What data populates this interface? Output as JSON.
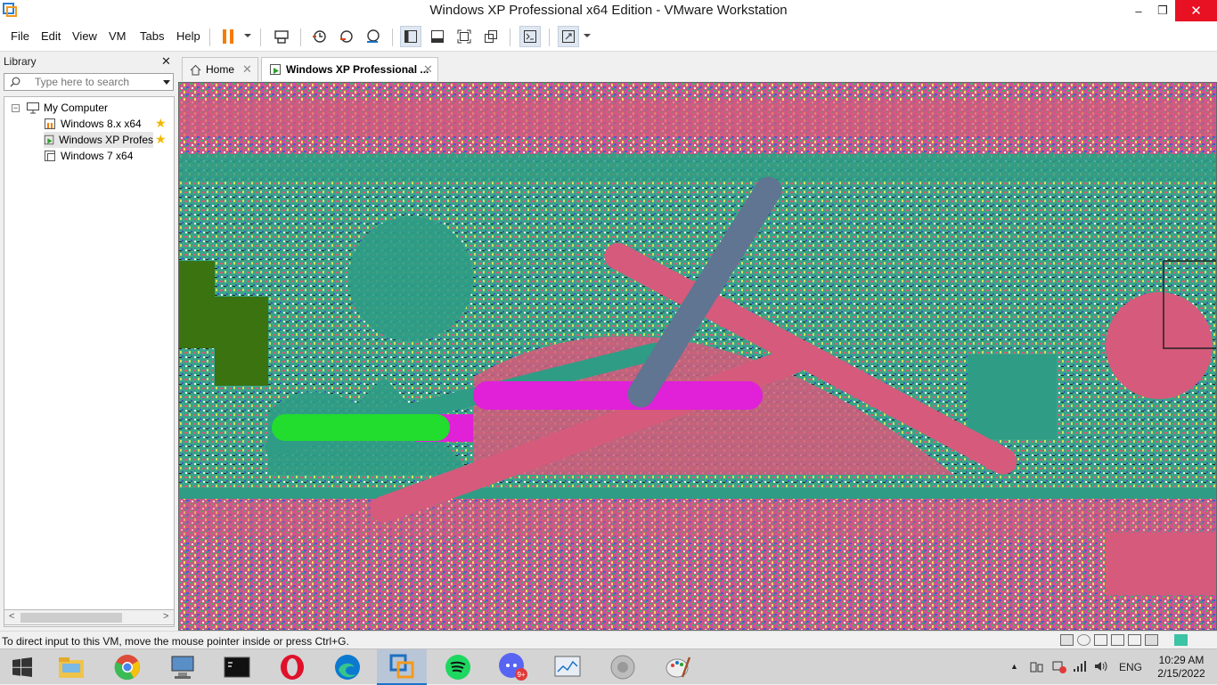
{
  "window": {
    "title": "Windows XP Professional x64 Edition - VMware Workstation",
    "minimize": "–",
    "maximize": "❐",
    "close": "✕"
  },
  "menu": {
    "items": [
      {
        "label": "File"
      },
      {
        "label": "Edit"
      },
      {
        "label": "View"
      },
      {
        "label": "VM"
      },
      {
        "label": "Tabs"
      },
      {
        "label": "Help"
      }
    ]
  },
  "library": {
    "title": "Library",
    "close": "✕",
    "search_placeholder": "Type here to search",
    "tree": {
      "root": "My Computer",
      "toggle": "−",
      "items": [
        {
          "label": "Windows 8.x x64",
          "favorite": true,
          "icon": "vm-suspended-icon"
        },
        {
          "label": "Windows XP Profes",
          "favorite": true,
          "icon": "vm-running-icon"
        },
        {
          "label": "Windows 7 x64",
          "favorite": false,
          "icon": "vm-icon"
        }
      ],
      "star": "★"
    },
    "scroll_left": "<",
    "scroll_right": ">"
  },
  "tabs": [
    {
      "label": "Home",
      "close": "✕"
    },
    {
      "label": "Windows XP Professional ...",
      "close": "✕"
    }
  ],
  "status": {
    "message": "To direct input to this VM, move the mouse pointer inside or press Ctrl+G."
  },
  "taskbar": {
    "apps": [
      {
        "name": "file-explorer"
      },
      {
        "name": "chrome"
      },
      {
        "name": "this-pc"
      },
      {
        "name": "command-prompt"
      },
      {
        "name": "opera"
      },
      {
        "name": "edge"
      },
      {
        "name": "vmware-workstation"
      },
      {
        "name": "spotify"
      },
      {
        "name": "discord",
        "badge": "9+"
      },
      {
        "name": "performance-monitor"
      },
      {
        "name": "speaker"
      },
      {
        "name": "paint"
      }
    ],
    "language": "ENG",
    "time": "10:29 AM",
    "date": "2/15/2022"
  },
  "colors": {
    "accent": "#1a73c8",
    "pause": "#f57c00",
    "close_red": "#e81123",
    "vm_teal": "#2f9c85",
    "vm_pink": "#d65a7c",
    "vm_magenta": "#e021d8",
    "vm_green": "#22dd2e",
    "vm_slate": "#5f7591",
    "vm_olive": "#3a7310"
  }
}
